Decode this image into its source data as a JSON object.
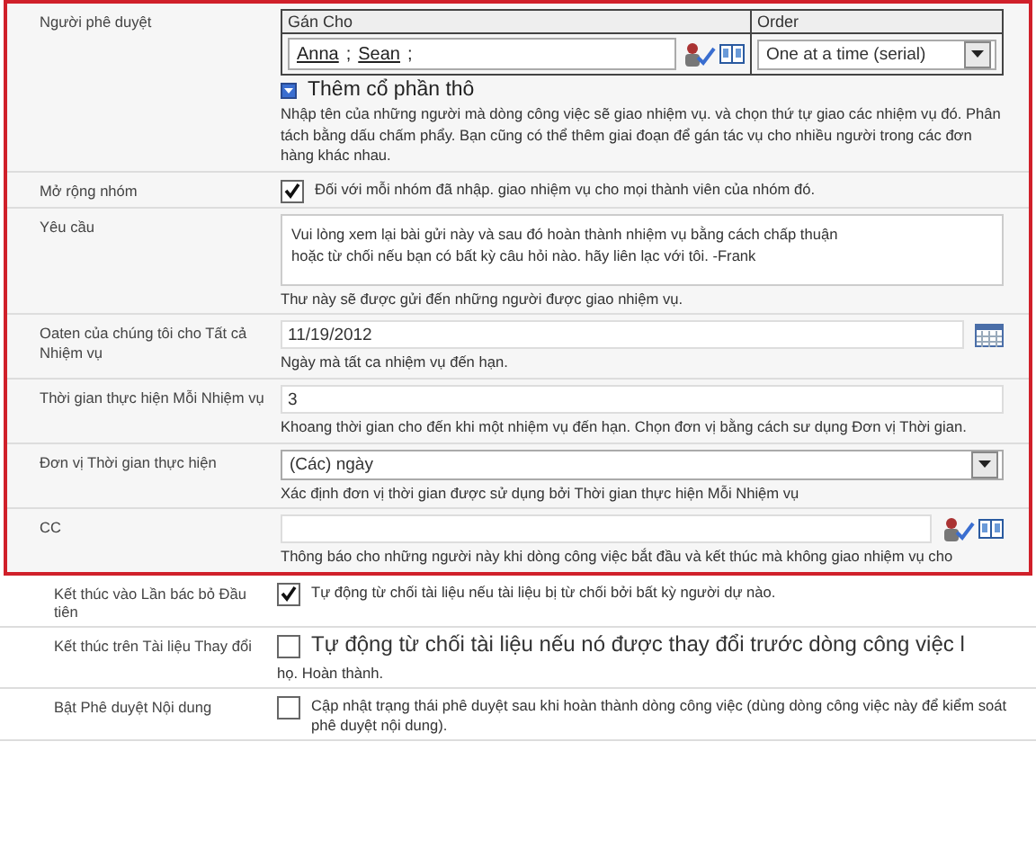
{
  "highlighted_section": {
    "rows": [
      {
        "kind": "approvers",
        "label": "Người phê duyệt",
        "columns": [
          "Gán Cho",
          "Order"
        ],
        "assignees": [
          "Anna",
          "Sean"
        ],
        "separator": ";",
        "order": "One at a time (serial)",
        "expander": {
          "label": "Thêm cổ phần thô",
          "expanded": false
        },
        "help": "Nhập tên của những người mà dòng công việc sẽ giao nhiệm vụ. và chọn thứ tự giao các nhiệm vụ đó. Phân tách bằng dấu chấm phẩy. Bạn cũng có thể thêm giai đoạn để gán tác vụ cho nhiều người trong các đơn hàng khác nhau."
      },
      {
        "kind": "checkbox",
        "label": "Mở rộng nhóm",
        "checked": true,
        "text": "Đối với mỗi nhóm đã nhập. giao nhiệm vụ cho mọi thành viên của nhóm đó."
      },
      {
        "kind": "textarea",
        "label": "Yêu cầu",
        "value": "Vui lòng xem lại bài gửi này và sau đó hoàn thành nhiệm vụ bằng cách chấp thuận\nhoặc từ chối nếu bạn có bất kỳ câu hỏi nào. hãy liên lạc với tôi. -Frank",
        "help": "Thư này sẽ được gửi đến những người được giao nhiệm vụ."
      },
      {
        "kind": "date",
        "label": "Oaten của chúng tôi cho Tất cả Nhiệm vụ",
        "value": "11/19/2012",
        "help": "Ngày mà tất ca nhiệm vụ đến hạn."
      },
      {
        "kind": "text",
        "label": "Thời gian thực hiện Mỗi Nhiệm vụ",
        "value": "3",
        "help": "Khoang thời gian cho đến khi một nhiệm vụ đến hạn. Chọn đơn vị bằng cách sư dụng Đơn vị Thời gian."
      },
      {
        "kind": "select",
        "label": "Đơn vị Thời gian thực hiện",
        "value": "(Các) ngày",
        "help": "Xác định đơn vị thời gian được sử dụng bởi Thời gian thực hiện Mỗi Nhiệm vụ"
      },
      {
        "kind": "people",
        "label": "CC",
        "help": "Thông báo cho những người này khi dòng công việc bắt đầu và kết thúc mà không giao nhiệm vụ cho"
      }
    ]
  },
  "rows": [
    {
      "kind": "checkbox",
      "label": "Kết thúc vào Lần bác bỏ Đầu tiên",
      "checked": true,
      "text": "Tự động từ chối tài liệu nếu tài liệu bị từ chối bởi bất kỳ người dự nào."
    },
    {
      "kind": "checkbox",
      "label": "Kết thúc trên Tài liệu Thay đổi",
      "checked": false,
      "text": "Tự động từ chối tài liệu nếu nó được thay đổi trước dòng công việc l",
      "continuation": "họ. Hoàn thành."
    },
    {
      "kind": "checkbox",
      "label": "Bật Phê duyệt Nội dung",
      "checked": false,
      "text": "Cập nhật trạng thái phê duyệt sau khi hoàn thành dòng công việc (dùng dòng công việc này để kiểm soát phê duyệt nội dung)."
    }
  ]
}
